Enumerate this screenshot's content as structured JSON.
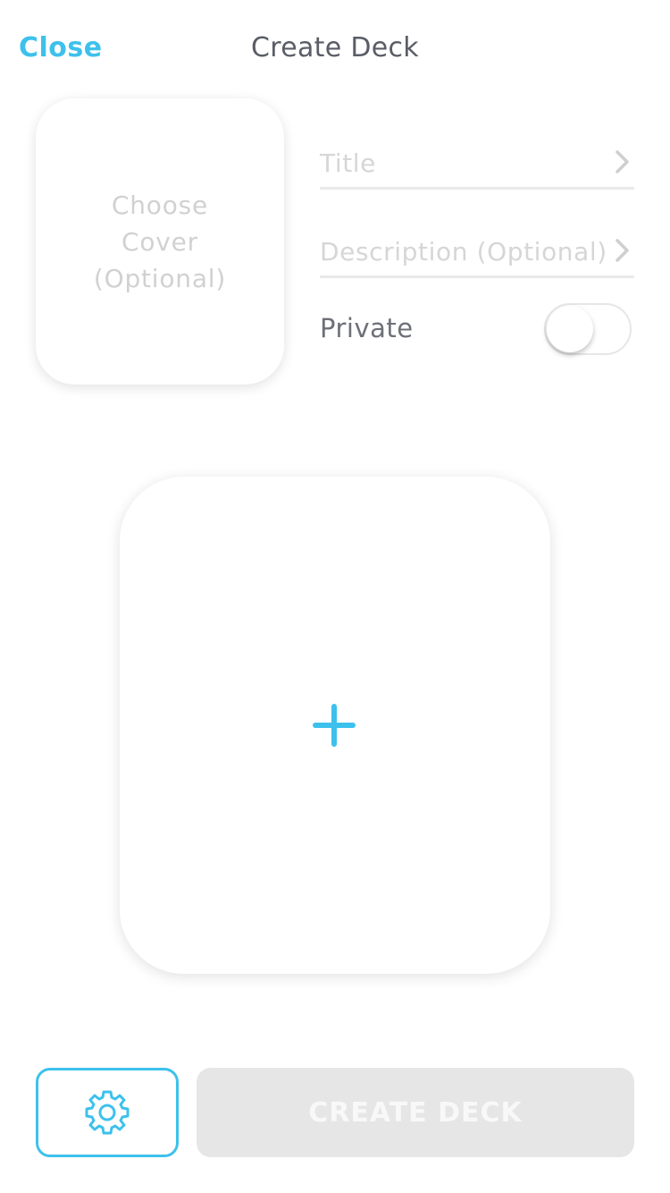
{
  "header": {
    "close_label": "Close",
    "title": "Create Deck"
  },
  "cover": {
    "label": "Choose\nCover\n(Optional)"
  },
  "form": {
    "title_placeholder": "Title",
    "description_placeholder": "Description (Optional)",
    "private_label": "Private",
    "private_enabled": false
  },
  "card": {
    "add_icon": "plus-icon"
  },
  "footer": {
    "settings_icon": "gear-icon",
    "create_label": "CREATE DECK"
  },
  "colors": {
    "accent": "#3dc1ec",
    "title_text": "#5a5d66",
    "placeholder": "#d6d6d6",
    "disabled_button": "#e6e6e6"
  }
}
